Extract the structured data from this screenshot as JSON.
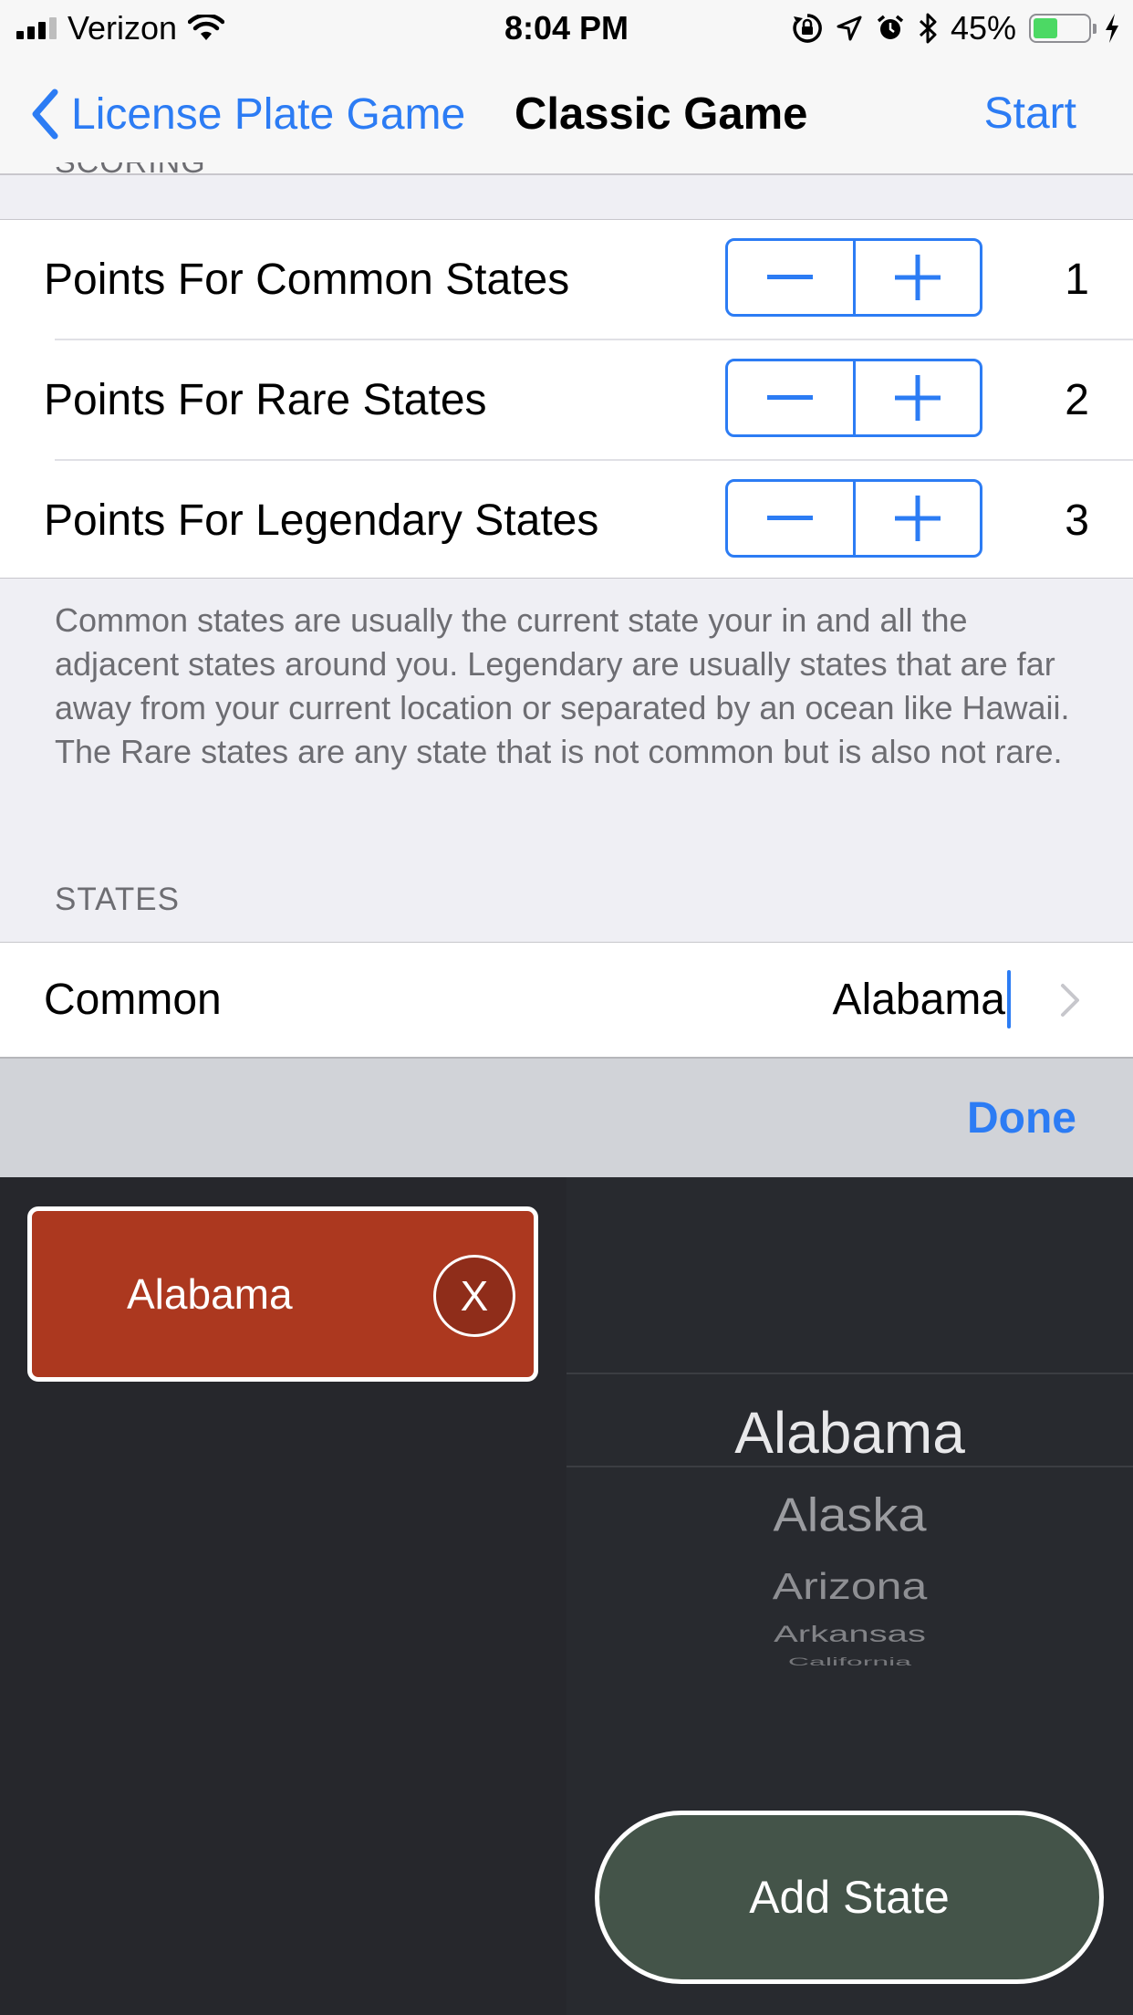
{
  "status_bar": {
    "carrier": "Verizon",
    "time": "8:04 PM",
    "battery_percent": "45%",
    "battery_level": 0.45,
    "icons": [
      "signal-icon",
      "wifi-icon",
      "rotation-lock-icon",
      "location-icon",
      "alarm-icon",
      "bluetooth-icon",
      "battery-icon",
      "charging-icon"
    ]
  },
  "nav": {
    "back_label": "License Plate Game",
    "title": "Classic Game",
    "start_label": "Start"
  },
  "scoring": {
    "header": "SCORING",
    "rows": [
      {
        "label": "Points For Common States",
        "value": "1"
      },
      {
        "label": "Points For Rare States",
        "value": "2"
      },
      {
        "label": "Points For Legendary States",
        "value": "3"
      }
    ],
    "footer": "Common states are usually the current state your in and all the adjacent states around you. Legendary are usually states that are far away from your current location or separated by an ocean like Hawaii. The Rare states are any state that is not common but is also not rare."
  },
  "states": {
    "header": "STATES",
    "common_label": "Common",
    "common_value": "Alabama"
  },
  "toolbar": {
    "done_label": "Done"
  },
  "selected_states": [
    {
      "label": "Alabama",
      "remove_label": "X"
    }
  ],
  "picker": {
    "items": [
      "Alabama",
      "Alaska",
      "Arizona",
      "Arkansas",
      "California"
    ],
    "selected": "Alabama"
  },
  "add_state_label": "Add State",
  "colors": {
    "accent": "#2c7cf4",
    "chip": "#ac381f",
    "add_button": "#445449",
    "dark_bg": "#282a2f"
  }
}
